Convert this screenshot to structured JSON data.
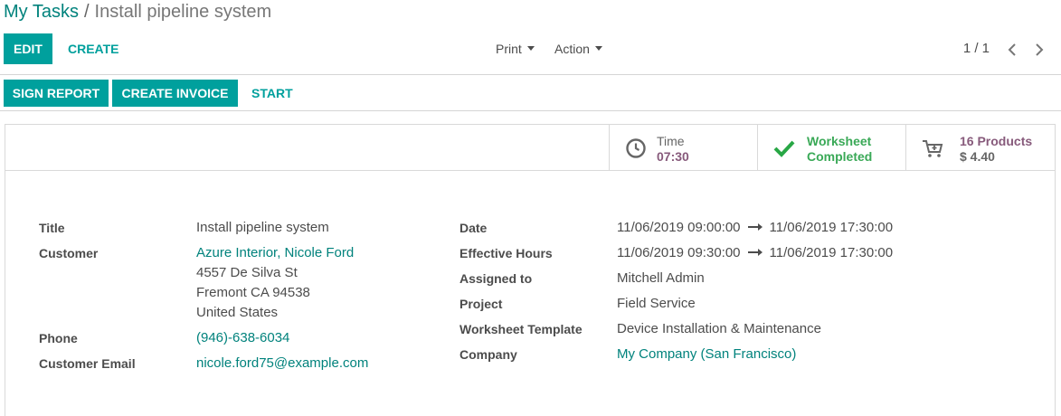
{
  "breadcrumb": {
    "parent": "My Tasks",
    "separator": "/",
    "current": "Install pipeline system"
  },
  "toolbar": {
    "edit_label": "EDIT",
    "create_label": "CREATE",
    "print_label": "Print",
    "action_label": "Action",
    "pager_value": "1 / 1"
  },
  "status_buttons": {
    "sign_report": "SIGN REPORT",
    "create_invoice": "CREATE INVOICE",
    "start": "START"
  },
  "stats": {
    "time": {
      "label": "Time",
      "value": "07:30"
    },
    "worksheet": {
      "line1": "Worksheet",
      "line2": "Completed"
    },
    "products": {
      "line1": "16 Products",
      "line2": "$ 4.40"
    }
  },
  "form": {
    "left": {
      "title": {
        "label": "Title",
        "value": "Install pipeline system"
      },
      "customer": {
        "label": "Customer",
        "name": "Azure Interior, Nicole Ford",
        "street": "4557 De Silva St",
        "city": "Fremont CA 94538",
        "country": "United States"
      },
      "phone": {
        "label": "Phone",
        "value": "(946)-638-6034"
      },
      "email": {
        "label": "Customer Email",
        "value": "nicole.ford75@example.com"
      }
    },
    "right": {
      "date": {
        "label": "Date",
        "start": "11/06/2019 09:00:00",
        "end": "11/06/2019 17:30:00"
      },
      "effective_hours": {
        "label": "Effective Hours",
        "start": "11/06/2019 09:30:00",
        "end": "11/06/2019 17:30:00"
      },
      "assigned_to": {
        "label": "Assigned to",
        "value": "Mitchell Admin"
      },
      "project": {
        "label": "Project",
        "value": "Field Service"
      },
      "worksheet_template": {
        "label": "Worksheet Template",
        "value": "Device Installation & Maintenance"
      },
      "company": {
        "label": "Company",
        "value": "My Company (San Francisco)"
      }
    }
  },
  "colors": {
    "primary": "#00a09d",
    "link": "#00827c",
    "purple": "#875a7b",
    "success": "#28a745"
  }
}
